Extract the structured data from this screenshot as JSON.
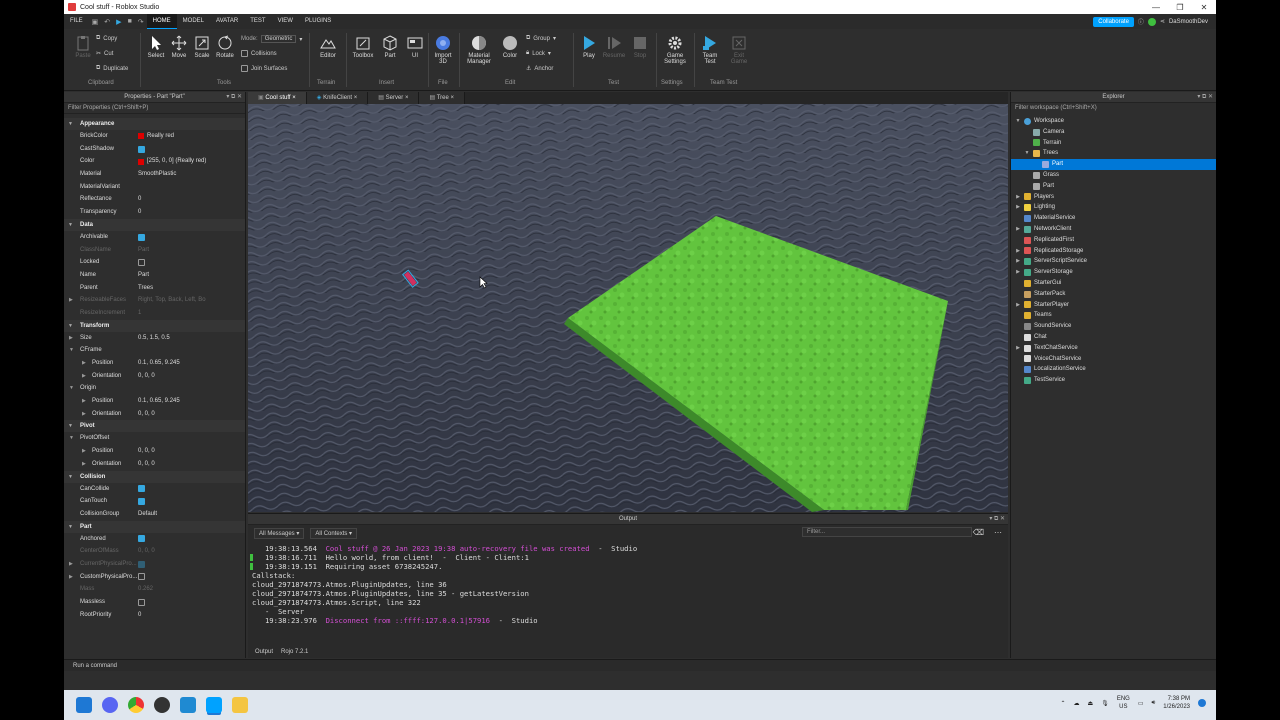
{
  "window": {
    "title": "Cool stuff - Roblox Studio",
    "controls": [
      "—",
      "❐",
      "✕"
    ]
  },
  "menu": {
    "items": [
      "FILE",
      "HOME",
      "MODEL",
      "AVATAR",
      "TEST",
      "VIEW",
      "PLUGINS"
    ],
    "active": "HOME",
    "collaborate": "Collaborate",
    "user": "DaSmoothDev"
  },
  "ribbon": {
    "clipboard": {
      "paste": "Paste",
      "copy": "Copy",
      "cut": "Cut",
      "duplicate": "Duplicate",
      "label": "Clipboard"
    },
    "tools": {
      "select": "Select",
      "move": "Move",
      "scale": "Scale",
      "rotate": "Rotate",
      "mode_label": "Mode:",
      "mode_value": "Geometric",
      "collisions": "Collisions",
      "join": "Join Surfaces",
      "label": "Tools"
    },
    "terrain": {
      "editor": "Editor",
      "label": "Terrain"
    },
    "insert": {
      "toolbox": "Toolbox",
      "part": "Part",
      "ui": "UI",
      "label": "Insert"
    },
    "file": {
      "import": "Import 3D",
      "label": "File"
    },
    "edit": {
      "material": "Material Manager",
      "color": "Color",
      "group": "Group",
      "lock": "Lock",
      "anchor": "Anchor",
      "label": "Edit"
    },
    "test": {
      "play": "Play",
      "resume": "Resume",
      "stop": "Stop",
      "label": "Test"
    },
    "settings": {
      "game": "Game Settings",
      "label": "Settings"
    },
    "teamtest": {
      "team": "Team Test",
      "exit": "Exit Game",
      "label": "Team Test"
    }
  },
  "properties": {
    "title": "Properties - Part \"Part\"",
    "filter": "Filter Properties (Ctrl+Shift+P)",
    "appearance": {
      "section": "Appearance",
      "brickcolor_k": "BrickColor",
      "brickcolor_v": "Really red",
      "castshadow_k": "CastShadow",
      "color_k": "Color",
      "color_v": "[255, 0, 0] (Really red)",
      "material_k": "Material",
      "material_v": "SmoothPlastic",
      "matvar_k": "MaterialVariant",
      "refl_k": "Reflectance",
      "refl_v": "0",
      "transp_k": "Transparency",
      "transp_v": "0"
    },
    "data": {
      "section": "Data",
      "archivable_k": "Archivable",
      "classname_k": "ClassName",
      "classname_v": "Part",
      "locked_k": "Locked",
      "name_k": "Name",
      "name_v": "Part",
      "parent_k": "Parent",
      "parent_v": "Trees",
      "resizeable_k": "ResizeableFaces",
      "resizeable_v": "Right, Top, Back, Left, Bo",
      "resizeinc_k": "ResizeIncrement",
      "resizeinc_v": "1"
    },
    "transform": {
      "section": "Transform",
      "size_k": "Size",
      "size_v": "0.5, 1.5, 0.5",
      "cframe_k": "CFrame",
      "position_k": "Position",
      "cf_pos_v": "0.1, 0.65, 9.245",
      "orientation_k": "Orientation",
      "cf_ori_v": "0, 0, 0",
      "origin_k": "Origin",
      "or_pos_v": "0.1, 0.65, 9.245",
      "or_ori_v": "0, 0, 0"
    },
    "pivot": {
      "section": "Pivot",
      "offset_k": "PivotOffset",
      "pos_v": "0, 0, 0",
      "ori_v": "0, 0, 0"
    },
    "collision": {
      "section": "Collision",
      "cancollide_k": "CanCollide",
      "cantouch_k": "CanTouch",
      "group_k": "CollisionGroup",
      "group_v": "Default"
    },
    "part": {
      "section": "Part",
      "anchored_k": "Anchored",
      "com_k": "CenterOfMass",
      "com_v": "0, 0, 0",
      "current_k": "CurrentPhysicalPro...",
      "custom_k": "CustomPhysicalPro...",
      "mass_k": "Mass",
      "mass_v": "0.262",
      "massless_k": "Massless",
      "rootprio_k": "RootPriority",
      "rootprio_v": "0"
    }
  },
  "tabs": [
    {
      "label": "Cool stuff",
      "close": "×"
    },
    {
      "label": "KnifeClient",
      "close": "×"
    },
    {
      "label": "Server",
      "close": "×"
    },
    {
      "label": "Tree",
      "close": "×"
    }
  ],
  "output": {
    "title": "Output",
    "all_messages": "All Messages",
    "all_contexts": "All Contexts",
    "filter": "Filter...",
    "lines": [
      "   19:38:13.564  ",
      "Cool stuff @ 26 Jan 2023 19:38 auto-recovery file was created",
      "  -  Studio",
      "   19:38:16.711  Hello world, from client!  -  Client - Client:1",
      "   19:38:19.151  Requiring asset 6738245247.",
      "Callstack:",
      "cloud_2971874773.Atmos.PluginUpdates, line 36",
      "cloud_2971874773.Atmos.PluginUpdates, line 35 - getLatestVersion",
      "cloud_2971874773.Atmos.Script, line 322",
      "   -  Server",
      "   19:38:23.976  ",
      "Disconnect from ::ffff:127.0.0.1|57916",
      "  -  Studio"
    ],
    "tab_output": "Output",
    "tab_rojo": "Rojo 7.2.1"
  },
  "explorer": {
    "title": "Explorer",
    "filter": "Filter workspace (Ctrl+Shift+X)",
    "items": [
      "Workspace",
      "Camera",
      "Terrain",
      "Trees",
      "Part",
      "Grass",
      "Part",
      "Players",
      "Lighting",
      "MaterialService",
      "NetworkClient",
      "ReplicatedFirst",
      "ReplicatedStorage",
      "ServerScriptService",
      "ServerStorage",
      "StarterGui",
      "StarterPack",
      "StarterPlayer",
      "Teams",
      "SoundService",
      "Chat",
      "TextChatService",
      "VoiceChatService",
      "LocalizationService",
      "TestService"
    ]
  },
  "command": {
    "placeholder": "Run a command"
  },
  "taskbar": {
    "lang1": "ENG",
    "lang2": "US",
    "time": "7:38 PM",
    "date": "1/26/2023"
  },
  "colors": {
    "accent": "#00a2ff",
    "grass": "#5cbf3a",
    "water": "#3d4352",
    "selection": "#0078d7",
    "magenta": "#d44fd4"
  }
}
